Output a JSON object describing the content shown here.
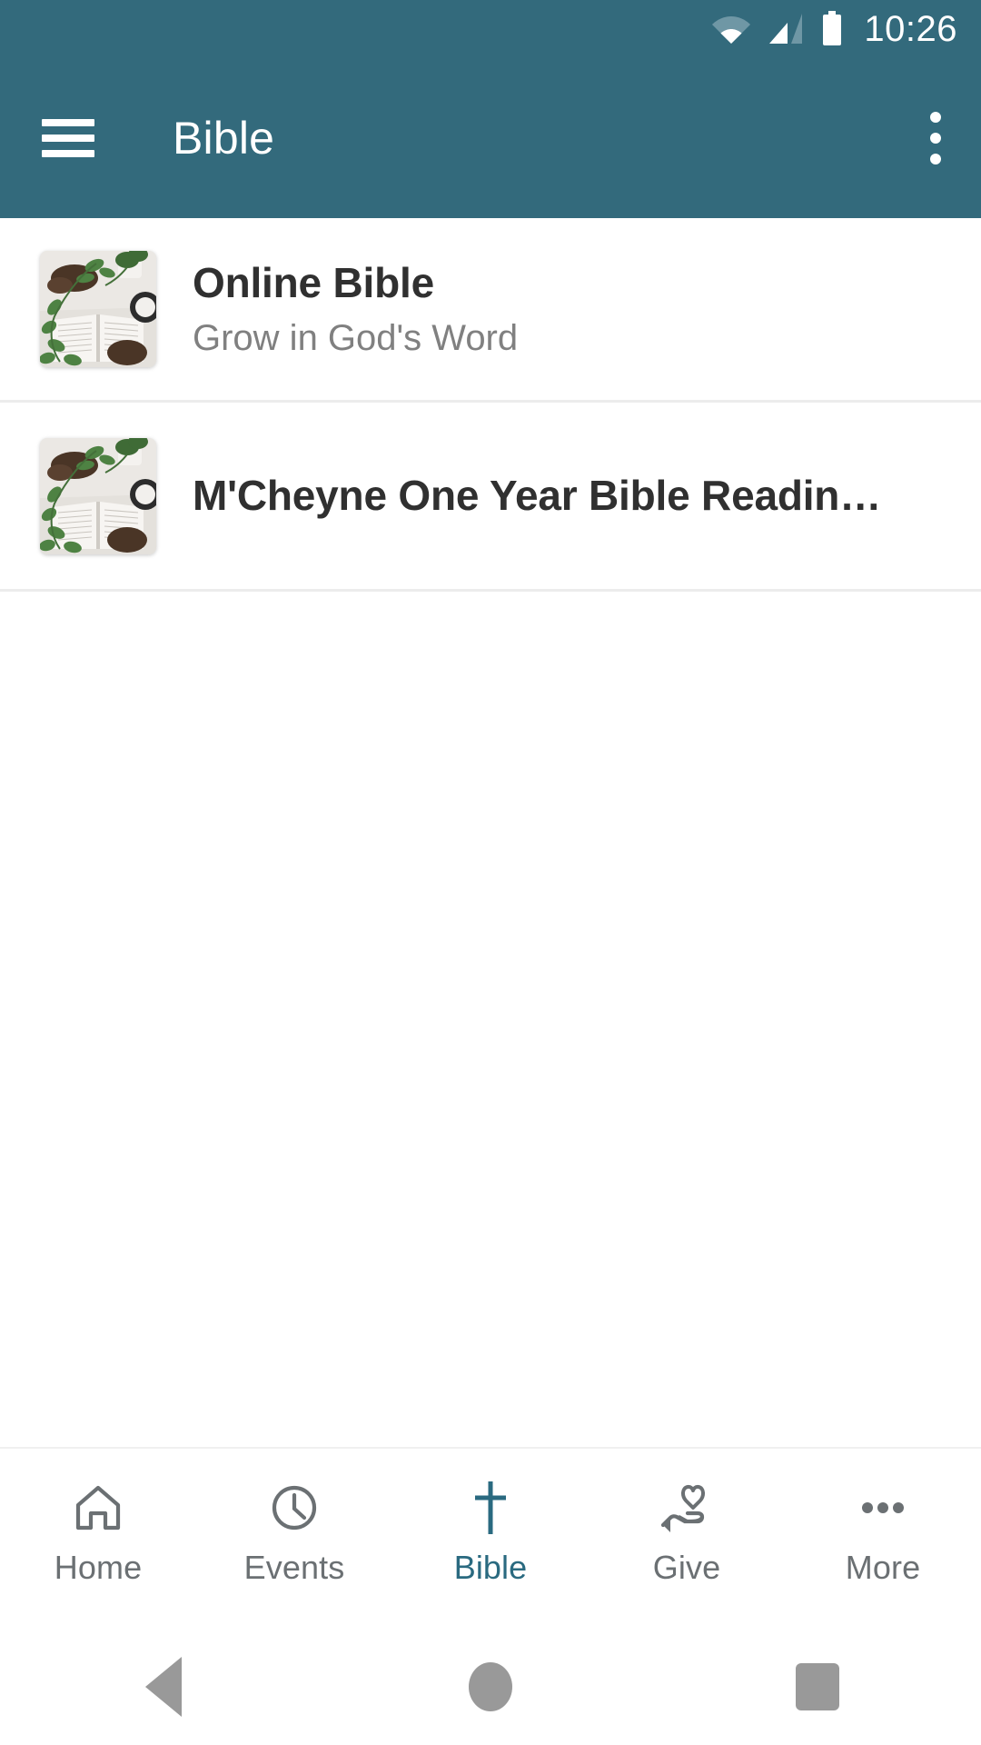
{
  "statusbar": {
    "time": "10:26",
    "wifi_icon": "wifi-icon",
    "signal_icon": "cell-signal-icon",
    "battery_icon": "battery-full-icon"
  },
  "appbar": {
    "menu_icon": "hamburger-menu-icon",
    "title": "Bible",
    "overflow_icon": "overflow-menu-icon",
    "background_color": "#336A7C"
  },
  "list": {
    "items": [
      {
        "title": "Online Bible",
        "subtitle": "Grow in God's Word",
        "thumbnail": "open-bible-with-plants-photo"
      },
      {
        "title": "M'Cheyne One Year Bible Readin…",
        "subtitle": "",
        "thumbnail": "open-bible-with-plants-photo"
      }
    ]
  },
  "tabbar": {
    "active_color": "#2a6a80",
    "inactive_color": "#6b7073",
    "tabs": [
      {
        "label": "Home",
        "icon": "home-icon",
        "active": false
      },
      {
        "label": "Events",
        "icon": "clock-icon",
        "active": false
      },
      {
        "label": "Bible",
        "icon": "cross-icon",
        "active": true
      },
      {
        "label": "Give",
        "icon": "hand-heart-icon",
        "active": false
      },
      {
        "label": "More",
        "icon": "ellipsis-icon",
        "active": false
      }
    ]
  },
  "sysnav": {
    "back_icon": "android-back-icon",
    "home_icon": "android-home-icon",
    "recents_icon": "android-recents-icon"
  }
}
